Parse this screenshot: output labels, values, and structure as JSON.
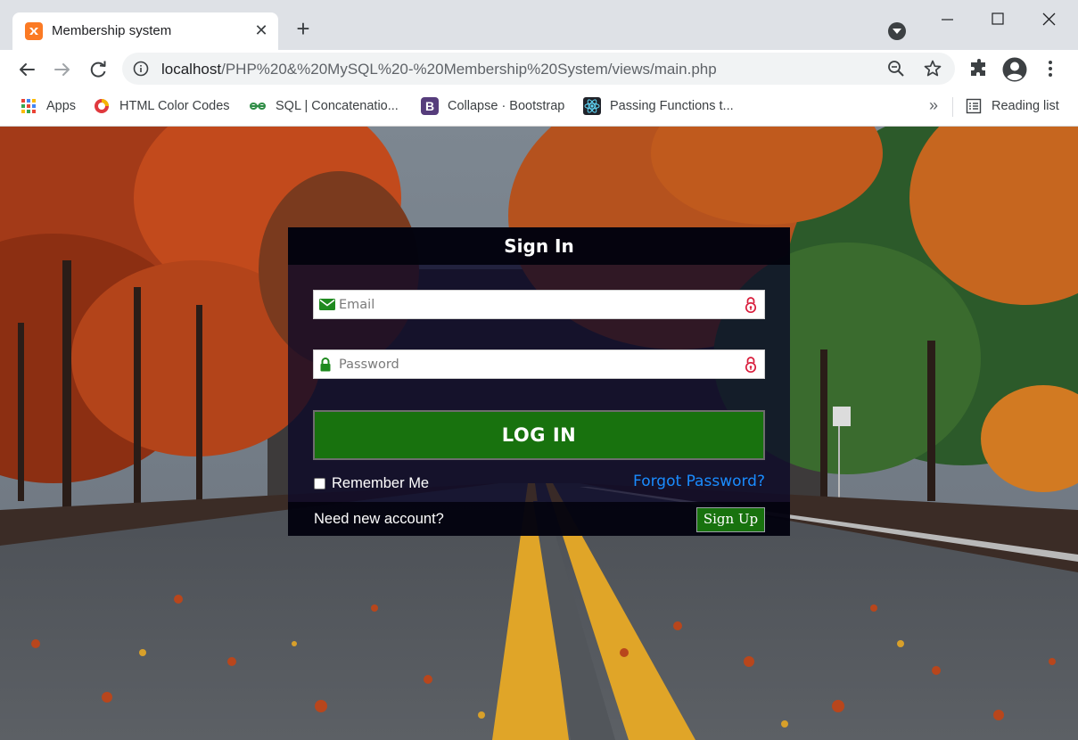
{
  "browser": {
    "tab": {
      "title": "Membership system",
      "close": "✕"
    },
    "new_tab": "+",
    "address": {
      "host": "localhost",
      "path": "/PHP%20&%20MySQL%20-%20Membership%20System/views/main.php"
    },
    "bookmarks": [
      {
        "label": "Apps",
        "icon": "apps-grid-icon"
      },
      {
        "label": "HTML Color Codes",
        "icon": "html-color-codes-icon"
      },
      {
        "label": "SQL | Concatenatio...",
        "icon": "geeksforgeeks-icon"
      },
      {
        "label": "Collapse · Bootstrap",
        "icon": "bootstrap-icon"
      },
      {
        "label": "Passing Functions t...",
        "icon": "react-icon"
      }
    ],
    "bookmarks_overflow": "»",
    "reading_list": "Reading list"
  },
  "signin": {
    "title": "Sign In",
    "email_placeholder": "Email",
    "password_placeholder": "Password",
    "login_label": "LOG IN",
    "remember_label": "Remember Me",
    "remember_checked": false,
    "forgot_label": "Forgot Password?",
    "need_account": "Need new account?",
    "signup_label": "Sign Up"
  },
  "colors": {
    "login_button": "#18720e",
    "forgot_link": "#1a8cff",
    "panel_background": "#0a0828",
    "input_icon_green": "#1f8a1f",
    "input_lock_red": "#d81b3a"
  }
}
